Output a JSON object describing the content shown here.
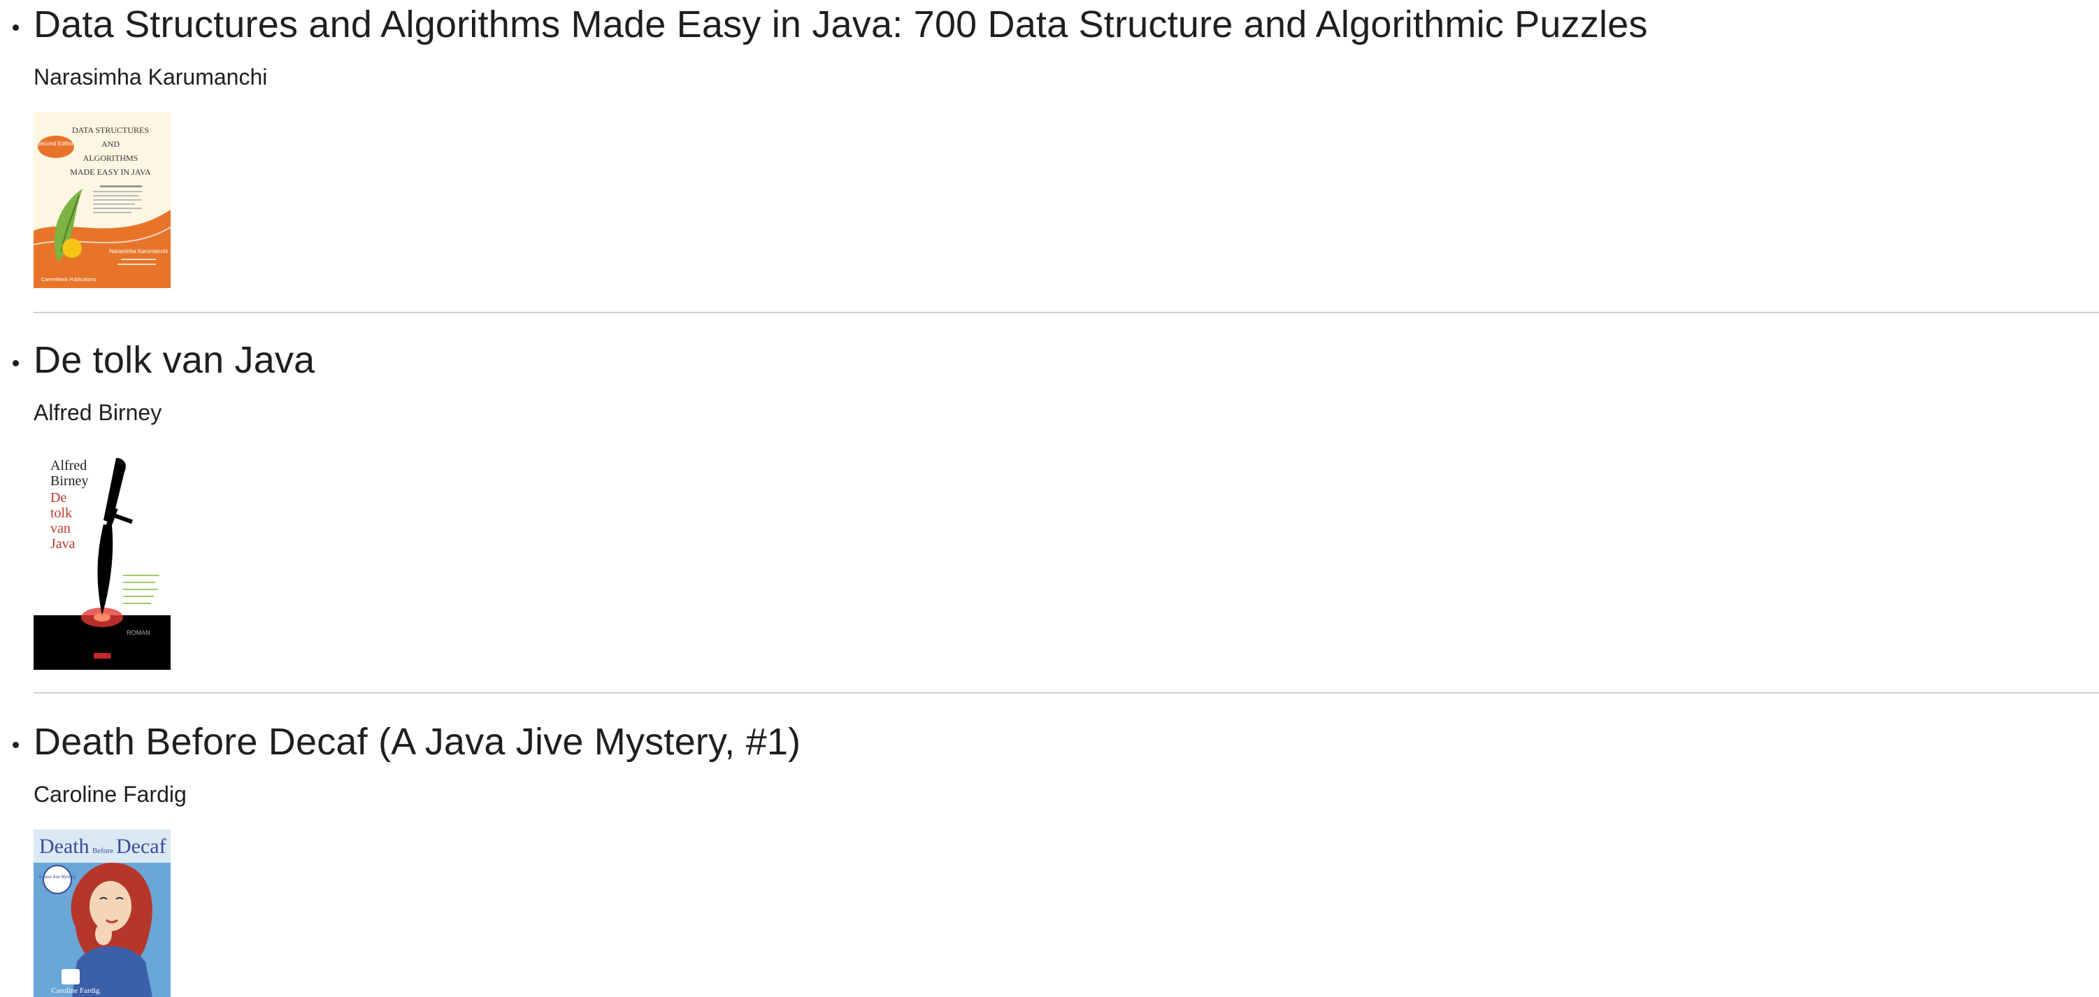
{
  "books": [
    {
      "title": "Data Structures and Algorithms Made Easy in Java: 700 Data Structure and Algorithmic Puzzles",
      "author": "Narasimha Karumanchi",
      "cover": {
        "title_lines": [
          "DATA STRUCTURES",
          "AND",
          "ALGORITHMS",
          "MADE EASY IN JAVA"
        ],
        "badge": "Second Edition",
        "author_line": "Narasimha Karumanchi",
        "publisher": "CareerMonk Publications",
        "colors": {
          "background": "#fdf6e3",
          "accent": "#e8742a",
          "leaf": "#7cb342"
        }
      }
    },
    {
      "title": "De tolk van Java",
      "author": "Alfred Birney",
      "cover": {
        "author_lines": [
          "Alfred",
          "Birney"
        ],
        "title_lines": [
          "De",
          "tolk",
          "van",
          "Java"
        ],
        "footer": "ROMAN",
        "colors": {
          "background": "#ffffff",
          "title": "#c0392b",
          "dagger": "#000000",
          "glow": "#e53935"
        }
      }
    },
    {
      "title": "Death Before Decaf (A Java Jive Mystery, #1)",
      "author": "Caroline Fardig",
      "cover": {
        "title_word_1": "Death",
        "title_word_2": "Before",
        "title_word_3": "Decaf",
        "badge": "A Java Jive Mystery",
        "footer": "Caroline Fardig",
        "colors": {
          "background": "#6aa6d6",
          "hair": "#b5372a",
          "skin": "#f5d5b8",
          "shirt": "#3b5fa8"
        }
      }
    }
  ]
}
